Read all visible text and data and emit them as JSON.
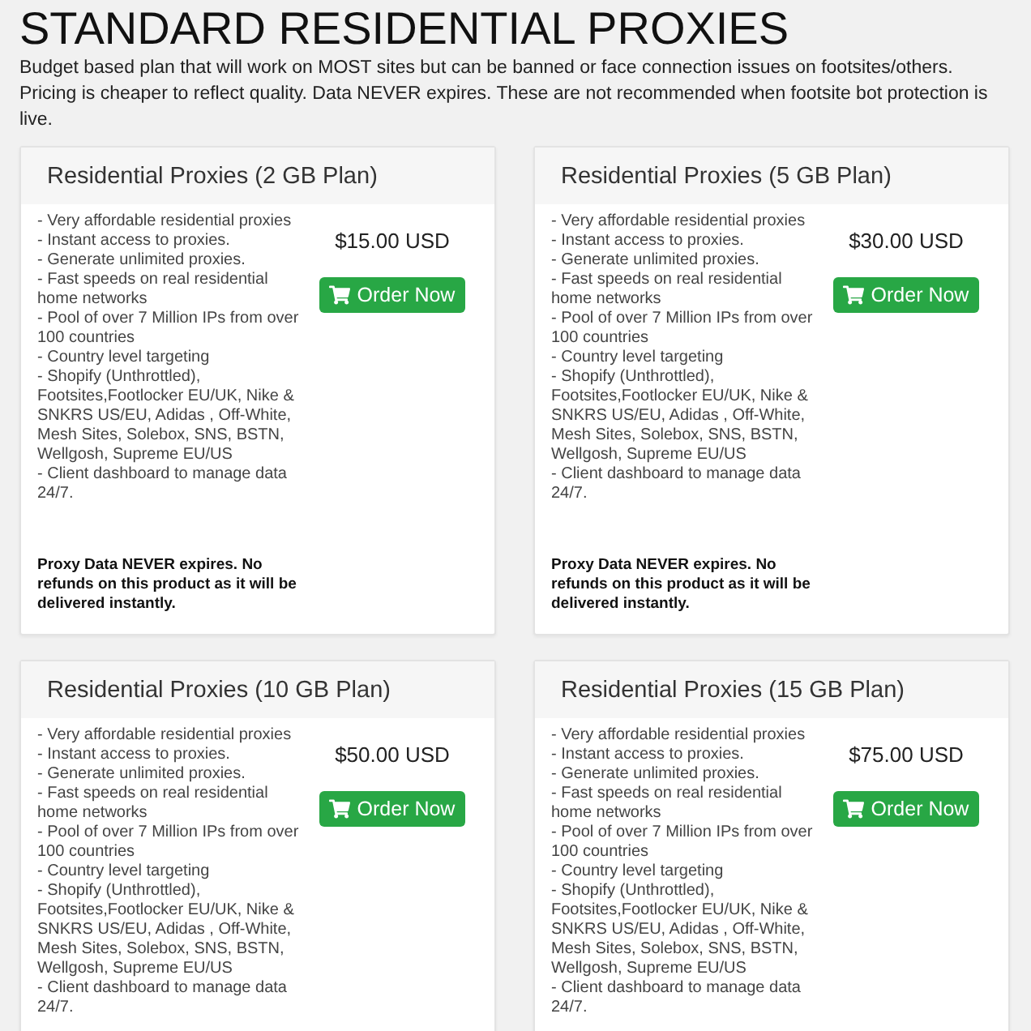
{
  "page": {
    "title": "STANDARD RESIDENTIAL PROXIES",
    "description": "Budget based plan that will work on MOST sites but can be banned or face connection issues on footsites/others. Pricing is cheaper to reflect quality. Data NEVER expires. These are not recommended when footsite bot protection is live."
  },
  "plans": [
    {
      "title": "Residential Proxies (2 GB Plan)",
      "features": [
        "- Very affordable residential proxies",
        "- Instant access to proxies.",
        "- Generate unlimited proxies.",
        "- Fast speeds on real residential home networks",
        "- Pool of over 7 Million IPs from over 100 countries",
        "- Country level targeting",
        "- Shopify (Unthrottled), Footsites,Footlocker EU/UK, Nike & SNKRS US/EU, Adidas , Off-White, Mesh Sites, Solebox, SNS, BSTN, Wellgosh, Supreme EU/US",
        "- Client dashboard to manage data 24/7."
      ],
      "price": "$15.00 USD",
      "button": "Order Now",
      "note": "Proxy Data NEVER expires. No refunds on this product as it will be delivered instantly."
    },
    {
      "title": "Residential Proxies (5 GB Plan)",
      "features": [
        "- Very affordable residential proxies",
        "- Instant access to proxies.",
        "- Generate unlimited proxies.",
        "- Fast speeds on real residential home networks",
        "- Pool of over 7 Million IPs from over 100 countries",
        "- Country level targeting",
        "- Shopify (Unthrottled), Footsites,Footlocker EU/UK, Nike & SNKRS US/EU, Adidas , Off-White, Mesh Sites, Solebox, SNS, BSTN, Wellgosh, Supreme EU/US",
        "- Client dashboard to manage data 24/7."
      ],
      "price": "$30.00 USD",
      "button": "Order Now",
      "note": "Proxy Data NEVER expires. No refunds on this product as it will be delivered instantly."
    },
    {
      "title": "Residential Proxies (10 GB Plan)",
      "features": [
        "- Very affordable residential proxies",
        "- Instant access to proxies.",
        "- Generate unlimited proxies.",
        "- Fast speeds on real residential home networks",
        "- Pool of over 7 Million IPs from over 100 countries",
        "- Country level targeting",
        "- Shopify (Unthrottled), Footsites,Footlocker EU/UK, Nike & SNKRS US/EU, Adidas , Off-White, Mesh Sites, Solebox, SNS, BSTN, Wellgosh, Supreme EU/US",
        "- Client dashboard to manage data 24/7."
      ],
      "price": "$50.00 USD",
      "button": "Order Now"
    },
    {
      "title": "Residential Proxies (15 GB Plan)",
      "features": [
        "- Very affordable residential proxies",
        "- Instant access to proxies.",
        "- Generate unlimited proxies.",
        "- Fast speeds on real residential home networks",
        "- Pool of over 7 Million IPs from over 100 countries",
        "- Country level targeting",
        "- Shopify (Unthrottled), Footsites,Footlocker EU/UK, Nike & SNKRS US/EU, Adidas , Off-White, Mesh Sites, Solebox, SNS, BSTN, Wellgosh, Supreme EU/US",
        "- Client dashboard to manage data 24/7."
      ],
      "price": "$75.00 USD",
      "button": "Order Now"
    }
  ]
}
